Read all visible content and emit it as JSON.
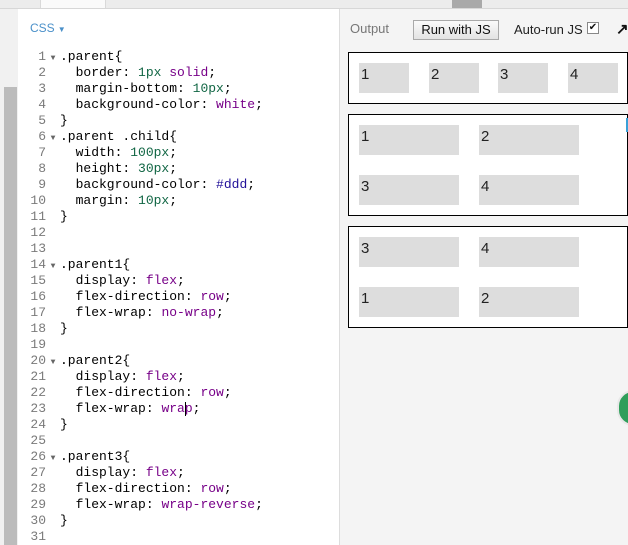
{
  "editor": {
    "language_label": "CSS",
    "lines": [
      {
        "n": "1",
        "fold": true,
        "tokens": [
          {
            "t": ".parent{",
            "c": "sel"
          }
        ]
      },
      {
        "n": "2",
        "fold": false,
        "tokens": [
          {
            "t": "  border",
            "c": "prop"
          },
          {
            "t": ": ",
            "c": "col"
          },
          {
            "t": "1px",
            "c": "num"
          },
          {
            "t": " solid",
            "c": "kw"
          },
          {
            "t": ";",
            "c": "col"
          }
        ]
      },
      {
        "n": "3",
        "fold": false,
        "tokens": [
          {
            "t": "  margin-bottom",
            "c": "prop"
          },
          {
            "t": ": ",
            "c": "col"
          },
          {
            "t": "10px",
            "c": "num"
          },
          {
            "t": ";",
            "c": "col"
          }
        ]
      },
      {
        "n": "4",
        "fold": false,
        "tokens": [
          {
            "t": "  background-color",
            "c": "prop"
          },
          {
            "t": ": ",
            "c": "col"
          },
          {
            "t": "white",
            "c": "kw"
          },
          {
            "t": ";",
            "c": "col"
          }
        ]
      },
      {
        "n": "5",
        "fold": false,
        "tokens": [
          {
            "t": "}",
            "c": "sel"
          }
        ]
      },
      {
        "n": "6",
        "fold": true,
        "tokens": [
          {
            "t": ".parent .child{",
            "c": "sel"
          }
        ]
      },
      {
        "n": "7",
        "fold": false,
        "tokens": [
          {
            "t": "  width",
            "c": "prop"
          },
          {
            "t": ": ",
            "c": "col"
          },
          {
            "t": "100px",
            "c": "num"
          },
          {
            "t": ";",
            "c": "col"
          }
        ]
      },
      {
        "n": "8",
        "fold": false,
        "tokens": [
          {
            "t": "  height",
            "c": "prop"
          },
          {
            "t": ": ",
            "c": "col"
          },
          {
            "t": "30px",
            "c": "num"
          },
          {
            "t": ";",
            "c": "col"
          }
        ]
      },
      {
        "n": "9",
        "fold": false,
        "tokens": [
          {
            "t": "  background-color",
            "c": "prop"
          },
          {
            "t": ": ",
            "c": "col"
          },
          {
            "t": "#ddd",
            "c": "val"
          },
          {
            "t": ";",
            "c": "col"
          }
        ]
      },
      {
        "n": "10",
        "fold": false,
        "tokens": [
          {
            "t": "  margin",
            "c": "prop"
          },
          {
            "t": ": ",
            "c": "col"
          },
          {
            "t": "10px",
            "c": "num"
          },
          {
            "t": ";",
            "c": "col"
          }
        ]
      },
      {
        "n": "11",
        "fold": false,
        "tokens": [
          {
            "t": "}",
            "c": "sel"
          }
        ]
      },
      {
        "n": "12",
        "fold": false,
        "tokens": []
      },
      {
        "n": "13",
        "fold": false,
        "tokens": []
      },
      {
        "n": "14",
        "fold": true,
        "tokens": [
          {
            "t": ".parent1{",
            "c": "sel"
          }
        ]
      },
      {
        "n": "15",
        "fold": false,
        "tokens": [
          {
            "t": "  display",
            "c": "prop"
          },
          {
            "t": ": ",
            "c": "col"
          },
          {
            "t": "flex",
            "c": "kw"
          },
          {
            "t": ";",
            "c": "col"
          }
        ]
      },
      {
        "n": "16",
        "fold": false,
        "tokens": [
          {
            "t": "  flex-direction",
            "c": "prop"
          },
          {
            "t": ": ",
            "c": "col"
          },
          {
            "t": "row",
            "c": "kw"
          },
          {
            "t": ";",
            "c": "col"
          }
        ]
      },
      {
        "n": "17",
        "fold": false,
        "tokens": [
          {
            "t": "  flex-wrap",
            "c": "prop"
          },
          {
            "t": ": ",
            "c": "col"
          },
          {
            "t": "no-wrap",
            "c": "kw"
          },
          {
            "t": ";",
            "c": "col"
          }
        ]
      },
      {
        "n": "18",
        "fold": false,
        "tokens": [
          {
            "t": "}",
            "c": "sel"
          }
        ]
      },
      {
        "n": "19",
        "fold": false,
        "tokens": []
      },
      {
        "n": "20",
        "fold": true,
        "tokens": [
          {
            "t": ".parent2{",
            "c": "sel"
          }
        ]
      },
      {
        "n": "21",
        "fold": false,
        "tokens": [
          {
            "t": "  display",
            "c": "prop"
          },
          {
            "t": ": ",
            "c": "col"
          },
          {
            "t": "flex",
            "c": "kw"
          },
          {
            "t": ";",
            "c": "col"
          }
        ]
      },
      {
        "n": "22",
        "fold": false,
        "tokens": [
          {
            "t": "  flex-direction",
            "c": "prop"
          },
          {
            "t": ": ",
            "c": "col"
          },
          {
            "t": "row",
            "c": "kw"
          },
          {
            "t": ";",
            "c": "col"
          }
        ]
      },
      {
        "n": "23",
        "fold": false,
        "tokens": [
          {
            "t": "  flex-wrap",
            "c": "prop"
          },
          {
            "t": ": ",
            "c": "col"
          },
          {
            "t": "wra",
            "c": "kw"
          },
          {
            "t": "|",
            "c": "cursor"
          },
          {
            "t": "p",
            "c": "kw"
          },
          {
            "t": ";",
            "c": "col"
          }
        ]
      },
      {
        "n": "24",
        "fold": false,
        "tokens": [
          {
            "t": "}",
            "c": "sel"
          }
        ]
      },
      {
        "n": "25",
        "fold": false,
        "tokens": []
      },
      {
        "n": "26",
        "fold": true,
        "tokens": [
          {
            "t": ".parent3{",
            "c": "sel"
          }
        ]
      },
      {
        "n": "27",
        "fold": false,
        "tokens": [
          {
            "t": "  display",
            "c": "prop"
          },
          {
            "t": ": ",
            "c": "col"
          },
          {
            "t": "flex",
            "c": "kw"
          },
          {
            "t": ";",
            "c": "col"
          }
        ]
      },
      {
        "n": "28",
        "fold": false,
        "tokens": [
          {
            "t": "  flex-direction",
            "c": "prop"
          },
          {
            "t": ": ",
            "c": "col"
          },
          {
            "t": "row",
            "c": "kw"
          },
          {
            "t": ";",
            "c": "col"
          }
        ]
      },
      {
        "n": "29",
        "fold": false,
        "tokens": [
          {
            "t": "  flex-wrap",
            "c": "prop"
          },
          {
            "t": ": ",
            "c": "col"
          },
          {
            "t": "wrap-reverse",
            "c": "kw"
          },
          {
            "t": ";",
            "c": "col"
          }
        ]
      },
      {
        "n": "30",
        "fold": false,
        "tokens": [
          {
            "t": "}",
            "c": "sel"
          }
        ]
      },
      {
        "n": "31",
        "fold": false,
        "tokens": []
      }
    ]
  },
  "output": {
    "label": "Output",
    "run_button": "Run with JS",
    "autorun_label": "Auto-run JS",
    "autorun_checked": "✔",
    "expand_icon": "↗",
    "box1": [
      "1",
      "2",
      "3",
      "4"
    ],
    "box2": [
      "1",
      "2",
      "3",
      "4"
    ],
    "box3": [
      "3",
      "4",
      "1",
      "2"
    ]
  }
}
